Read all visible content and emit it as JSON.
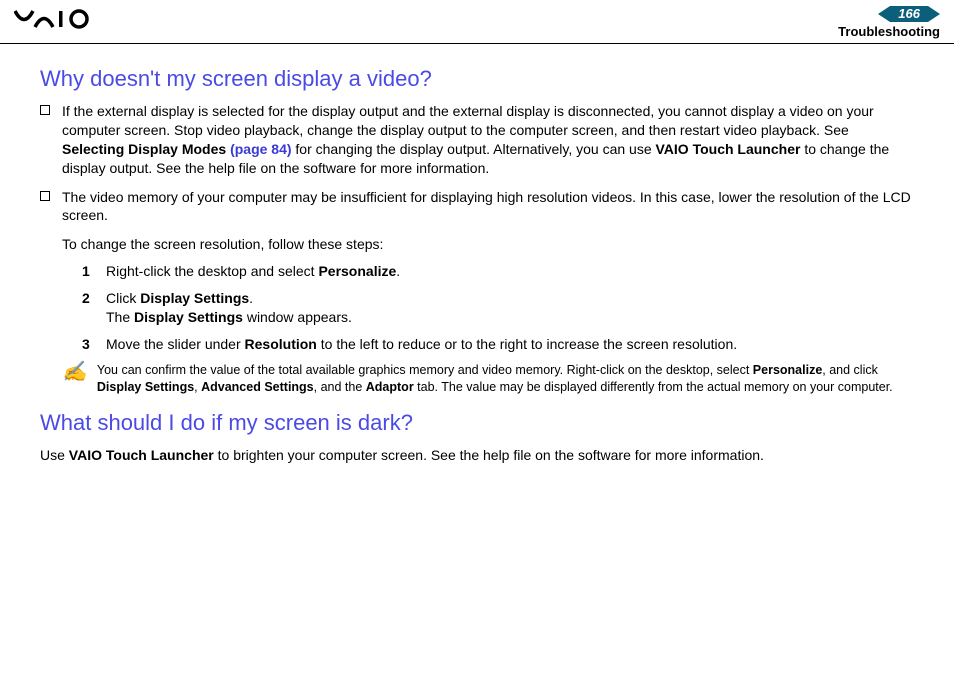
{
  "header": {
    "page_number": "166",
    "section": "Troubleshooting"
  },
  "q1": {
    "title": "Why doesn't my screen display a video?",
    "b1_a": "If the external display is selected for the display output and the external display is disconnected, you cannot display a video on your computer screen. Stop video playback, change the display output to the computer screen, and then restart video playback. See ",
    "b1_bold1": "Selecting Display Modes ",
    "b1_link": "(page 84)",
    "b1_b": " for changing the display output. Alternatively, you can use ",
    "b1_bold2": "VAIO Touch Launcher",
    "b1_c": " to change the display output. See the help file on the software for more information.",
    "b2": "The video memory of your computer may be insufficient for displaying high resolution videos. In this case, lower the resolution of the LCD screen.",
    "change_intro": "To change the screen resolution, follow these steps:",
    "s1_a": "Right-click the desktop and select ",
    "s1_b": "Personalize",
    "s1_c": ".",
    "s2_a": "Click ",
    "s2_b": "Display Settings",
    "s2_c": ".",
    "s2_d": "The ",
    "s2_e": "Display Settings",
    "s2_f": " window appears.",
    "s3_a": "Move the slider under ",
    "s3_b": "Resolution",
    "s3_c": " to the left to reduce or to the right to increase the screen resolution.",
    "note_a": "You can confirm the value of the total available graphics memory and video memory. Right-click on the desktop, select ",
    "note_b1": "Personalize",
    "note_c1": ", and click ",
    "note_b2": "Display Settings",
    "note_c2": ", ",
    "note_b3": "Advanced Settings",
    "note_c3": ", and the ",
    "note_b4": "Adaptor",
    "note_c4": " tab. The value may be displayed differently from the actual memory on your computer."
  },
  "q2": {
    "title": "What should I do if my screen is dark?",
    "p1_a": "Use ",
    "p1_b": "VAIO Touch Launcher",
    "p1_c": " to brighten your computer screen. See the help file on the software for more information."
  },
  "nums": {
    "n1": "1",
    "n2": "2",
    "n3": "3"
  }
}
